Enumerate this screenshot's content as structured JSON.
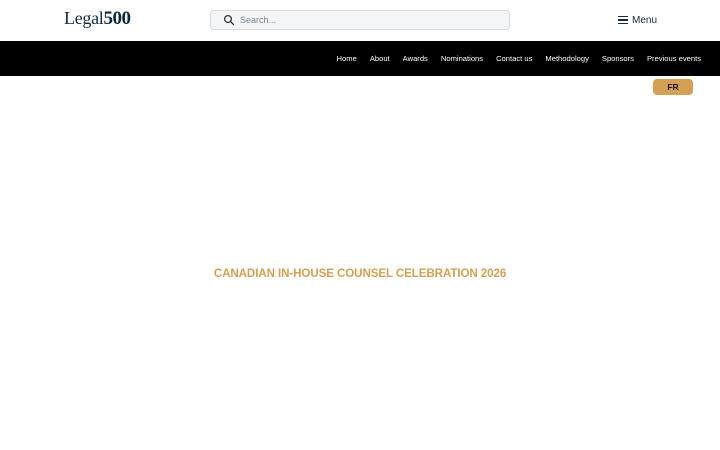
{
  "header": {
    "logo": {
      "word": "Legal",
      "number": "500"
    },
    "search": {
      "placeholder": "Search..."
    },
    "menu": {
      "label": "Menu"
    }
  },
  "nav": {
    "items": [
      {
        "label": "Home"
      },
      {
        "label": "About"
      },
      {
        "label": "Awards"
      },
      {
        "label": "Nominations"
      },
      {
        "label": "Contact us"
      },
      {
        "label": "Methodology"
      },
      {
        "label": "Sponsors"
      },
      {
        "label": "Previous events"
      }
    ]
  },
  "language_button": {
    "label": "FR"
  },
  "hero": {
    "title": "CANADIAN IN-HOUSE COUNSEL CELEBRATION 2026"
  },
  "colors": {
    "accent": "#d4a053",
    "nav_background": "#000000",
    "logo": "#0f2a3d"
  },
  "icons": {
    "search": "search-icon",
    "menu": "hamburger-menu-icon"
  }
}
